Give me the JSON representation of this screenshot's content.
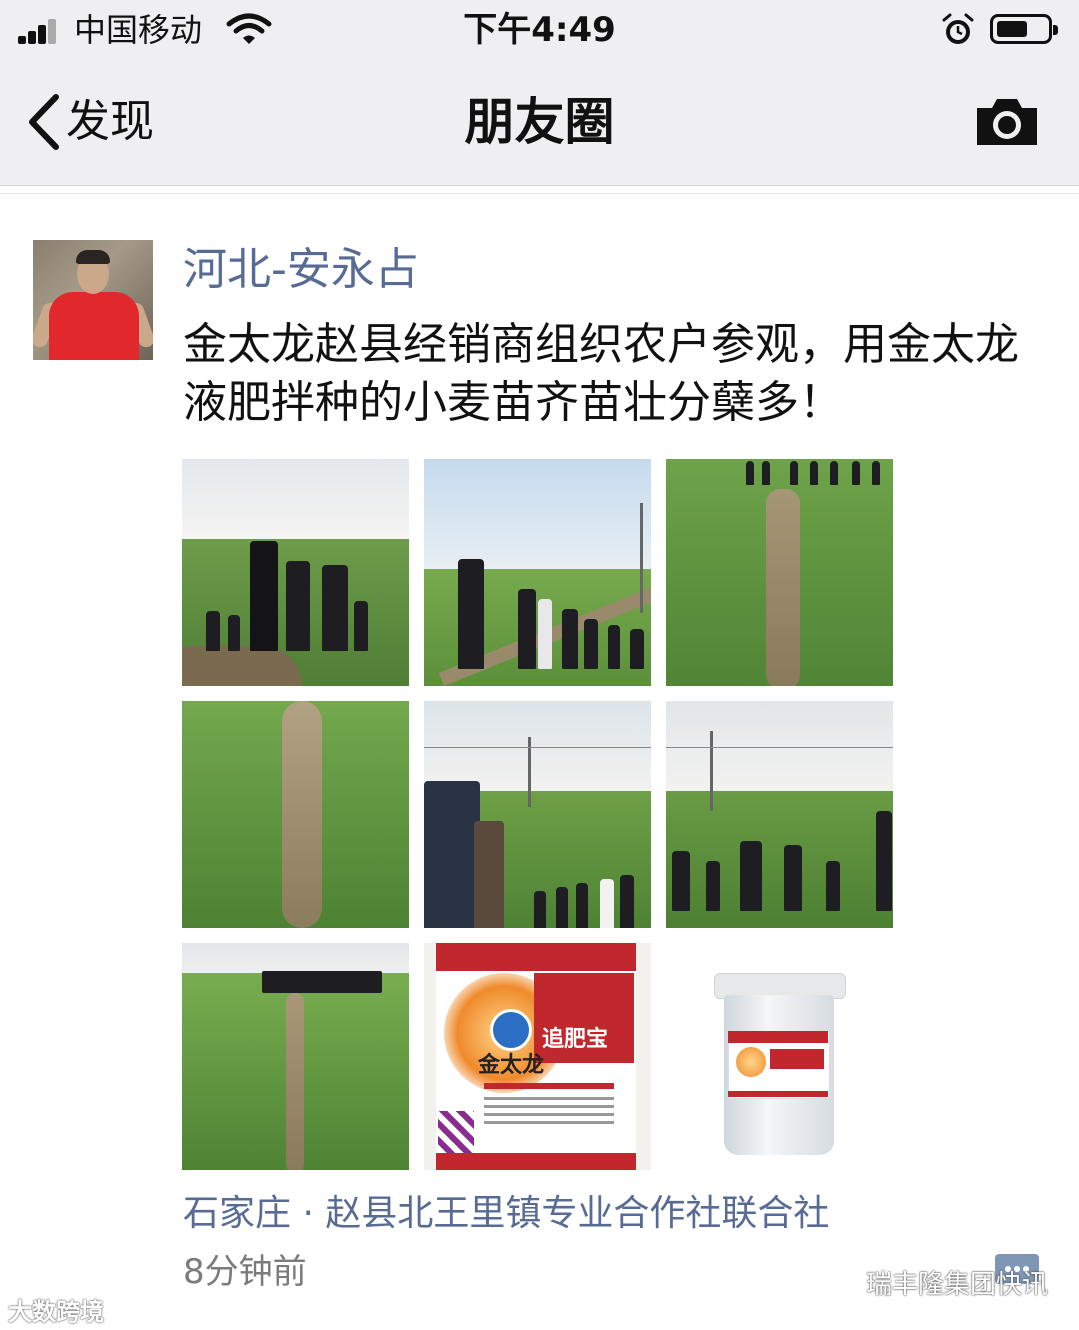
{
  "status_bar": {
    "carrier": "中国移动",
    "time": "下午4:49"
  },
  "nav": {
    "back_label": "发现",
    "title": "朋友圈"
  },
  "post": {
    "author": "河北-安永占",
    "text": "金太龙赵县经销商组织农户参观，用金太龙液肥拌种的小麦苗齐苗壮分蘖多！",
    "location": "石家庄 · 赵县北王里镇专业合作社联合社",
    "time_ago": "8分钟前",
    "product_label": "金太龙",
    "product_subtitle": "追肥宝"
  },
  "watermarks": {
    "left": "大数跨境",
    "right": "瑞丰隆集团快讯"
  },
  "colors": {
    "nav_bg": "#efeff1",
    "link": "#576b95",
    "field_green": "#5f9a3c",
    "product_red": "#c0282d"
  }
}
